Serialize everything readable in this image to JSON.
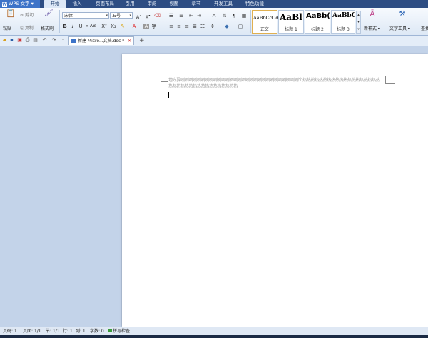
{
  "app": {
    "name": "WPS 文字"
  },
  "menu_tabs": [
    "开始",
    "插入",
    "页面布局",
    "引用",
    "审阅",
    "视图",
    "章节",
    "开发工具",
    "特色功能"
  ],
  "ribbon": {
    "paste": "粘贴",
    "cut": "剪切",
    "copy": "复制",
    "format_painter": "格式刷",
    "font_name": "宋体",
    "font_size": "五号",
    "styles": [
      {
        "sample": "AaBbCcDd",
        "name": "正文"
      },
      {
        "sample": "AaBl",
        "name": "标题 1"
      },
      {
        "sample": "AaBb(",
        "name": "标题 2"
      },
      {
        "sample": "AaBbC",
        "name": "标题 3"
      }
    ],
    "new_style": "新样式",
    "text_tools": "文字工具",
    "find": "查找"
  },
  "document_tab": {
    "title": "新建 Micro...文档.doc *"
  },
  "document": {
    "line1": "地方要咧咧咧咧咧咧咧咧咧咧咧咧咧咧咧咧咧咧咧咧咧咧咧咧咧咧咧咧咧个热热热热热热热热热热热热热热热热热热热",
    "line2": "热热热热热热热热热热热热热热热热热"
  },
  "status": {
    "page_num": "页码: 1",
    "pages": "页面: 1/1",
    "section": "节: 1/1",
    "row": "行: 1",
    "col": "列: 1",
    "word_count": "字数: 0",
    "spell_check": "拼写检查"
  }
}
